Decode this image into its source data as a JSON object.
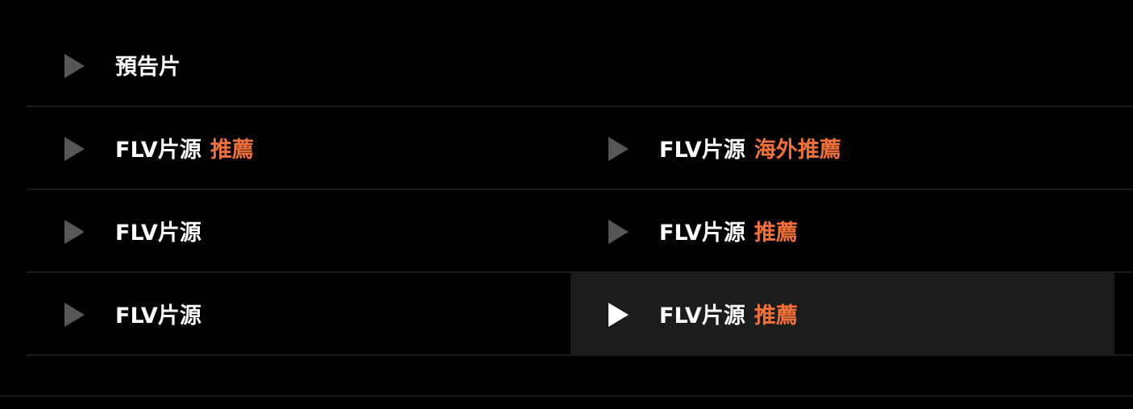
{
  "episodes": {
    "rows": [
      [
        {
          "title": "預告片",
          "tag": "",
          "active": false
        }
      ],
      [
        {
          "title": "FLV片源",
          "tag": "推薦",
          "active": false
        },
        {
          "title": "FLV片源",
          "tag": "海外推薦",
          "active": false
        }
      ],
      [
        {
          "title": "FLV片源",
          "tag": "",
          "active": false
        },
        {
          "title": "FLV片源",
          "tag": "推薦",
          "active": false
        }
      ],
      [
        {
          "title": "FLV片源",
          "tag": "",
          "active": false
        },
        {
          "title": "FLV片源",
          "tag": "推薦",
          "active": true
        }
      ]
    ]
  },
  "colors": {
    "background": "#000000",
    "title": "#ffffff",
    "tag": "#f0703a",
    "icon_inactive": "#565656",
    "icon_active": "#ffffff",
    "active_bg": "#1c1c1c",
    "divider": "#1b1b1b"
  },
  "icons": {
    "play": "play-icon"
  }
}
